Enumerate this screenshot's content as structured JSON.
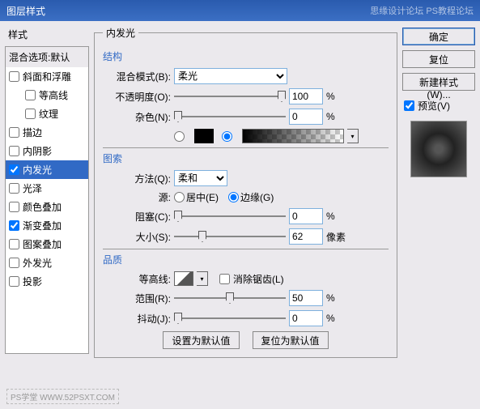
{
  "window": {
    "title": "图层样式",
    "watermark_right": "思缘设计论坛  PS教程论坛"
  },
  "left": {
    "header": "样式",
    "blend_defaults": "混合选项:默认",
    "items": [
      {
        "label": "斜面和浮雕",
        "checked": false
      },
      {
        "label": "等高线",
        "checked": false,
        "indent": true
      },
      {
        "label": "纹理",
        "checked": false,
        "indent": true
      },
      {
        "label": "描边",
        "checked": false
      },
      {
        "label": "内阴影",
        "checked": false
      },
      {
        "label": "内发光",
        "checked": true,
        "selected": true
      },
      {
        "label": "光泽",
        "checked": false
      },
      {
        "label": "颜色叠加",
        "checked": false
      },
      {
        "label": "渐变叠加",
        "checked": true
      },
      {
        "label": "图案叠加",
        "checked": false
      },
      {
        "label": "外发光",
        "checked": false
      },
      {
        "label": "投影",
        "checked": false
      }
    ]
  },
  "center": {
    "group_title": "内发光",
    "structure": {
      "legend": "结构",
      "blend_mode_label": "混合模式(B):",
      "blend_mode_value": "柔光",
      "opacity_label": "不透明度(O):",
      "opacity_value": "100",
      "percent": "%",
      "noise_label": "杂色(N):",
      "noise_value": "0"
    },
    "elements": {
      "legend": "图索",
      "technique_label": "方法(Q):",
      "technique_value": "柔和",
      "source_label": "源:",
      "source_center": "居中(E)",
      "source_edge": "边缘(G)",
      "choke_label": "阻塞(C):",
      "choke_value": "0",
      "size_label": "大小(S):",
      "size_value": "62",
      "size_unit": "像素"
    },
    "quality": {
      "legend": "品质",
      "contour_label": "等高线:",
      "antialias_label": "消除锯齿(L)",
      "range_label": "范围(R):",
      "range_value": "50",
      "jitter_label": "抖动(J):",
      "jitter_value": "0"
    },
    "buttons": {
      "set_default": "设置为默认值",
      "reset_default": "复位为默认值"
    }
  },
  "right": {
    "ok": "确定",
    "cancel": "复位",
    "new_style": "新建样式(W)...",
    "preview": "预览(V)"
  },
  "footer": {
    "watermark": "PS学堂   WWW.52PSXT.COM"
  }
}
